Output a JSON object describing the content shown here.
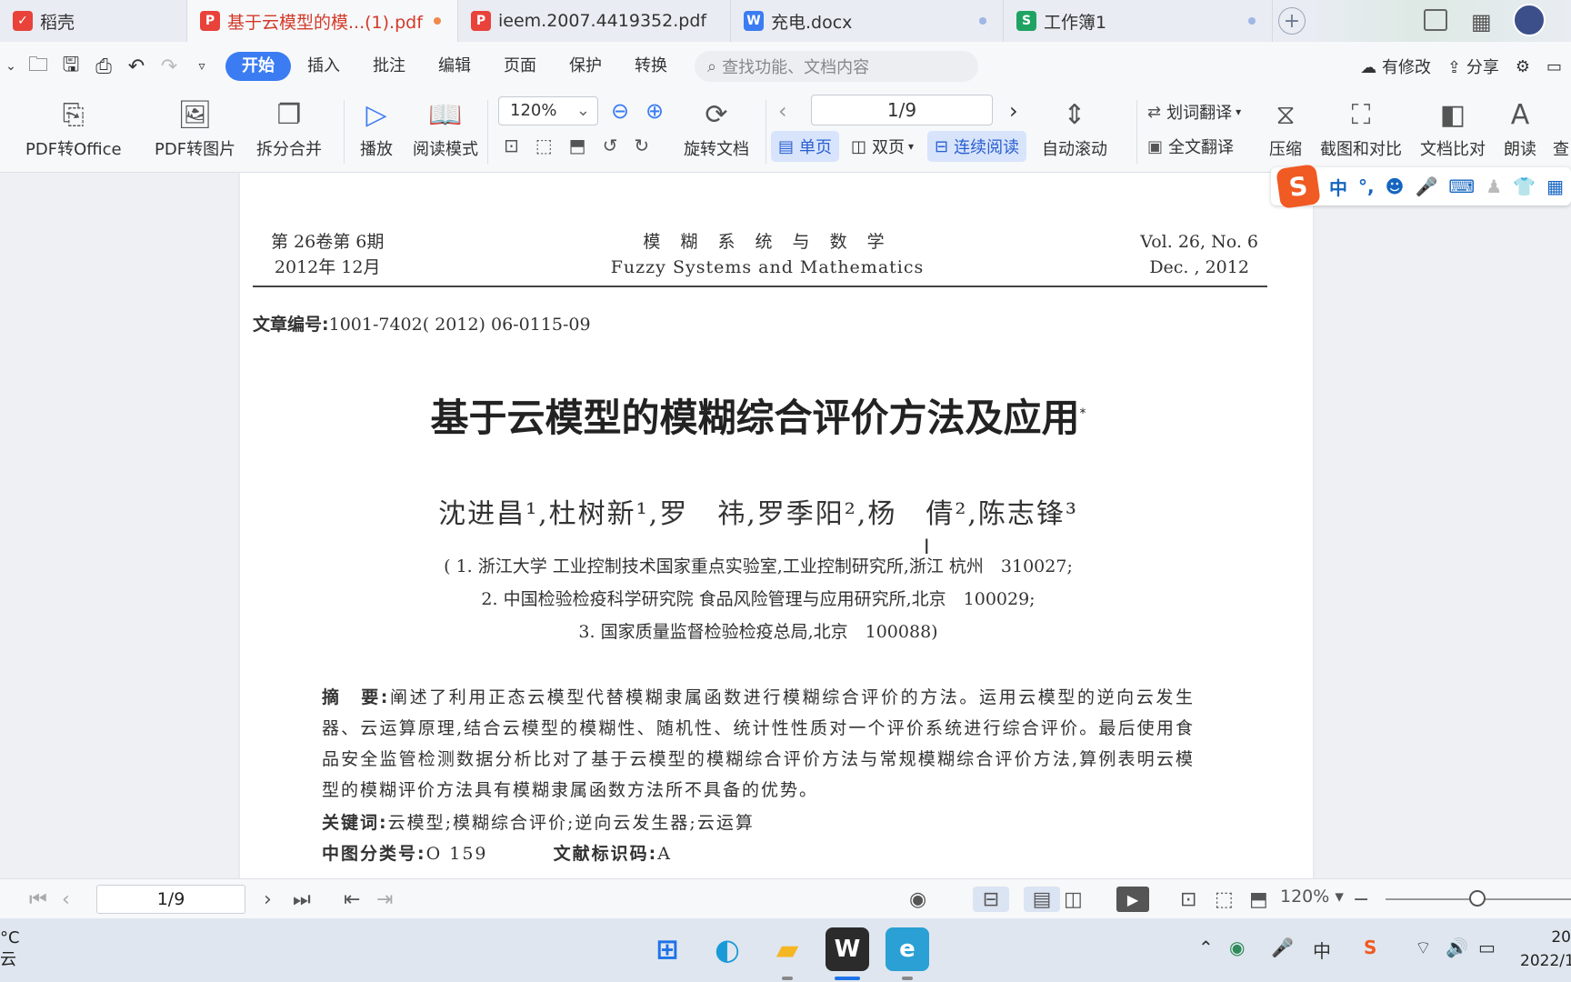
{
  "tabs": [
    {
      "label": "稻壳",
      "icon": "docer-icon",
      "color": "#e8423a"
    },
    {
      "label": "基于云模型的模...(1).pdf",
      "icon": "pdf-icon",
      "color": "#e8423a",
      "active": true
    },
    {
      "label": "ieem.2007.4419352.pdf",
      "icon": "pdf-icon",
      "color": "#e8423a"
    },
    {
      "label": "充电.docx",
      "icon": "word-icon",
      "color": "#3b7cf3"
    },
    {
      "label": "工作簿1",
      "icon": "sheet-icon",
      "color": "#1fa363"
    }
  ],
  "menu": {
    "items": [
      "开始",
      "插入",
      "批注",
      "编辑",
      "页面",
      "保护",
      "转换"
    ],
    "search_placeholder": "查找功能、文档内容",
    "modified": "有修改",
    "share": "分享"
  },
  "ribbon": {
    "pdf_to_office": "PDF转Office",
    "pdf_to_image": "PDF转图片",
    "split_merge": "拆分合并",
    "play": "播放",
    "reading_mode": "阅读模式",
    "zoom": "120%",
    "rotate_doc": "旋转文档",
    "page": "1/9",
    "single_page": "单页",
    "double_page": "双页",
    "continuous": "连续阅读",
    "auto_scroll": "自动滚动",
    "word_translate": "划词翻译",
    "full_translate": "全文翻译",
    "compress": "压缩",
    "screenshot_compare": "截图和对比",
    "doc_compare": "文档比对",
    "read_aloud": "朗读",
    "find": "查"
  },
  "ime": {
    "mode": "中",
    "punct": "°,"
  },
  "document": {
    "header_left_1": "第 26卷第 6期",
    "header_left_2": "2012年 12月",
    "header_center_cn": "模 糊 系 统 与 数 学",
    "header_center_en": "Fuzzy Systems and Mathematics",
    "header_right_1": "Vol. 26, No. 6",
    "header_right_2": "Dec. , 2012",
    "article_no_label": "文章编号:",
    "article_no": "1001-7402( 2012) 06-0115-09",
    "title": "基于云模型的模糊综合评价方法及应用",
    "title_mark": "*",
    "authors": "沈进昌¹,杜树新¹,罗　祎,罗季阳²,杨　倩²,陈志锋³",
    "affil_1": "( 1. 浙江大学 工业控制技术国家重点实验室,工业控制研究所,浙江 杭州　310027;",
    "affil_2": "2. 中国检验检疫科学研究院 食品风险管理与应用研究所,北京　100029;",
    "affil_3": "3. 国家质量监督检验检疫总局,北京　100088)",
    "abstract_label": "摘　要:",
    "abstract": "阐述了利用正态云模型代替模糊隶属函数进行模糊综合评价的方法。运用云模型的逆向云发生器、云运算原理,结合云模型的模糊性、随机性、统计性性质对一个评价系统进行综合评价。最后使用食品安全监管检测数据分析比对了基于云模型的模糊综合评价方法与常规模糊综合评价方法,算例表明云模型的模糊评价方法具有模糊隶属函数方法所不具备的优势。",
    "keywords_label": "关键词:",
    "keywords": "云模型;模糊综合评价;逆向云发生器;云运算",
    "clc_label": "中图分类号:",
    "clc": "O 159",
    "doc_code_label": "文献标识码:",
    "doc_code": "A"
  },
  "statusbar": {
    "page": "1/9",
    "zoom": "120%"
  },
  "taskbar": {
    "weather_unit": "°C",
    "weather_text": "云",
    "ime_lang": "中",
    "date": "2022/1",
    "year_prefix": "20"
  }
}
